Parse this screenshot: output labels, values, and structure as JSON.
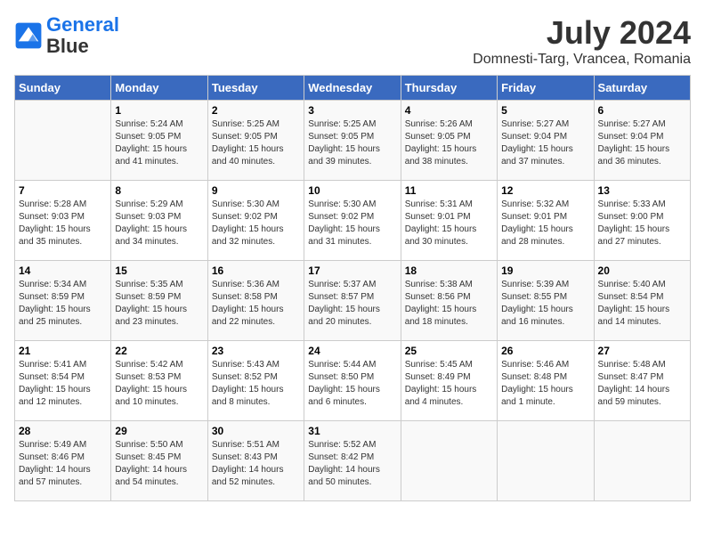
{
  "header": {
    "logo_line1": "General",
    "logo_line2": "Blue",
    "month_year": "July 2024",
    "location": "Domnesti-Targ, Vrancea, Romania"
  },
  "days_of_week": [
    "Sunday",
    "Monday",
    "Tuesday",
    "Wednesday",
    "Thursday",
    "Friday",
    "Saturday"
  ],
  "weeks": [
    [
      {
        "day": "",
        "info": ""
      },
      {
        "day": "1",
        "info": "Sunrise: 5:24 AM\nSunset: 9:05 PM\nDaylight: 15 hours\nand 41 minutes."
      },
      {
        "day": "2",
        "info": "Sunrise: 5:25 AM\nSunset: 9:05 PM\nDaylight: 15 hours\nand 40 minutes."
      },
      {
        "day": "3",
        "info": "Sunrise: 5:25 AM\nSunset: 9:05 PM\nDaylight: 15 hours\nand 39 minutes."
      },
      {
        "day": "4",
        "info": "Sunrise: 5:26 AM\nSunset: 9:05 PM\nDaylight: 15 hours\nand 38 minutes."
      },
      {
        "day": "5",
        "info": "Sunrise: 5:27 AM\nSunset: 9:04 PM\nDaylight: 15 hours\nand 37 minutes."
      },
      {
        "day": "6",
        "info": "Sunrise: 5:27 AM\nSunset: 9:04 PM\nDaylight: 15 hours\nand 36 minutes."
      }
    ],
    [
      {
        "day": "7",
        "info": "Sunrise: 5:28 AM\nSunset: 9:03 PM\nDaylight: 15 hours\nand 35 minutes."
      },
      {
        "day": "8",
        "info": "Sunrise: 5:29 AM\nSunset: 9:03 PM\nDaylight: 15 hours\nand 34 minutes."
      },
      {
        "day": "9",
        "info": "Sunrise: 5:30 AM\nSunset: 9:02 PM\nDaylight: 15 hours\nand 32 minutes."
      },
      {
        "day": "10",
        "info": "Sunrise: 5:30 AM\nSunset: 9:02 PM\nDaylight: 15 hours\nand 31 minutes."
      },
      {
        "day": "11",
        "info": "Sunrise: 5:31 AM\nSunset: 9:01 PM\nDaylight: 15 hours\nand 30 minutes."
      },
      {
        "day": "12",
        "info": "Sunrise: 5:32 AM\nSunset: 9:01 PM\nDaylight: 15 hours\nand 28 minutes."
      },
      {
        "day": "13",
        "info": "Sunrise: 5:33 AM\nSunset: 9:00 PM\nDaylight: 15 hours\nand 27 minutes."
      }
    ],
    [
      {
        "day": "14",
        "info": "Sunrise: 5:34 AM\nSunset: 8:59 PM\nDaylight: 15 hours\nand 25 minutes."
      },
      {
        "day": "15",
        "info": "Sunrise: 5:35 AM\nSunset: 8:59 PM\nDaylight: 15 hours\nand 23 minutes."
      },
      {
        "day": "16",
        "info": "Sunrise: 5:36 AM\nSunset: 8:58 PM\nDaylight: 15 hours\nand 22 minutes."
      },
      {
        "day": "17",
        "info": "Sunrise: 5:37 AM\nSunset: 8:57 PM\nDaylight: 15 hours\nand 20 minutes."
      },
      {
        "day": "18",
        "info": "Sunrise: 5:38 AM\nSunset: 8:56 PM\nDaylight: 15 hours\nand 18 minutes."
      },
      {
        "day": "19",
        "info": "Sunrise: 5:39 AM\nSunset: 8:55 PM\nDaylight: 15 hours\nand 16 minutes."
      },
      {
        "day": "20",
        "info": "Sunrise: 5:40 AM\nSunset: 8:54 PM\nDaylight: 15 hours\nand 14 minutes."
      }
    ],
    [
      {
        "day": "21",
        "info": "Sunrise: 5:41 AM\nSunset: 8:54 PM\nDaylight: 15 hours\nand 12 minutes."
      },
      {
        "day": "22",
        "info": "Sunrise: 5:42 AM\nSunset: 8:53 PM\nDaylight: 15 hours\nand 10 minutes."
      },
      {
        "day": "23",
        "info": "Sunrise: 5:43 AM\nSunset: 8:52 PM\nDaylight: 15 hours\nand 8 minutes."
      },
      {
        "day": "24",
        "info": "Sunrise: 5:44 AM\nSunset: 8:50 PM\nDaylight: 15 hours\nand 6 minutes."
      },
      {
        "day": "25",
        "info": "Sunrise: 5:45 AM\nSunset: 8:49 PM\nDaylight: 15 hours\nand 4 minutes."
      },
      {
        "day": "26",
        "info": "Sunrise: 5:46 AM\nSunset: 8:48 PM\nDaylight: 15 hours\nand 1 minute."
      },
      {
        "day": "27",
        "info": "Sunrise: 5:48 AM\nSunset: 8:47 PM\nDaylight: 14 hours\nand 59 minutes."
      }
    ],
    [
      {
        "day": "28",
        "info": "Sunrise: 5:49 AM\nSunset: 8:46 PM\nDaylight: 14 hours\nand 57 minutes."
      },
      {
        "day": "29",
        "info": "Sunrise: 5:50 AM\nSunset: 8:45 PM\nDaylight: 14 hours\nand 54 minutes."
      },
      {
        "day": "30",
        "info": "Sunrise: 5:51 AM\nSunset: 8:43 PM\nDaylight: 14 hours\nand 52 minutes."
      },
      {
        "day": "31",
        "info": "Sunrise: 5:52 AM\nSunset: 8:42 PM\nDaylight: 14 hours\nand 50 minutes."
      },
      {
        "day": "",
        "info": ""
      },
      {
        "day": "",
        "info": ""
      },
      {
        "day": "",
        "info": ""
      }
    ]
  ]
}
